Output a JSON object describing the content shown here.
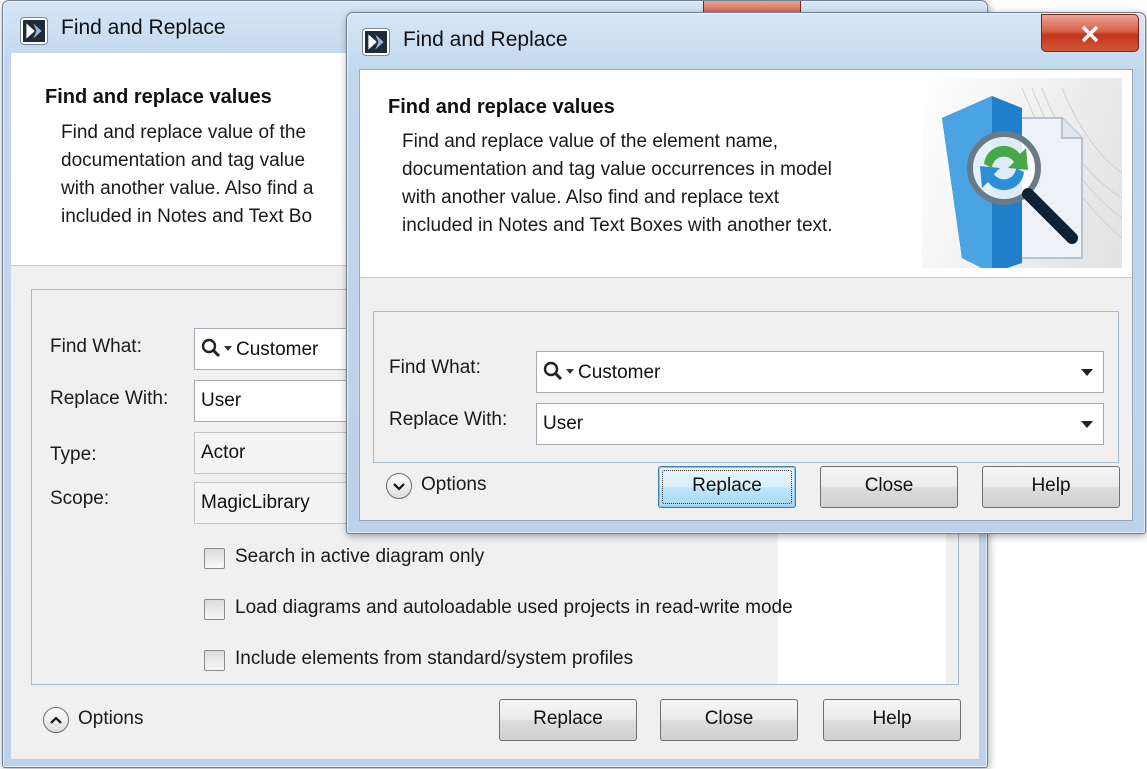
{
  "back_dialog": {
    "title": "Find and Replace",
    "header_title": "Find and replace values",
    "header_desc_lines": [
      "Find and replace value of the",
      "documentation and tag value",
      "with another value. Also find a",
      "included in Notes and Text Bo"
    ],
    "fields": {
      "find_label": "Find What:",
      "find_value": "Customer",
      "replace_label": "Replace With:",
      "replace_value": "User",
      "type_label": "Type:",
      "type_value": "Actor",
      "scope_label": "Scope:",
      "scope_value": "MagicLibrary"
    },
    "checkboxes": [
      {
        "label": "Search in active diagram only",
        "checked": false
      },
      {
        "label": "Load diagrams and autoloadable used projects in read-write mode",
        "checked": false
      },
      {
        "label": "Include elements from standard/system profiles",
        "checked": false
      }
    ],
    "options_label": "Options",
    "options_icon": "chevron-up-icon",
    "buttons": {
      "replace": "Replace",
      "close": "Close",
      "help": "Help"
    }
  },
  "front_dialog": {
    "title": "Find and Replace",
    "close_glyph": "x",
    "header_title": "Find and replace values",
    "header_desc": "Find and replace value of the element name,\ndocumentation and tag value occurrences in model\nwith another value. Also find and replace text\nincluded in Notes and Text Boxes with another text.",
    "fields": {
      "find_label": "Find What:",
      "find_value": "Customer",
      "replace_label": "Replace With:",
      "replace_value": "User"
    },
    "options_label": "Options",
    "options_icon": "chevron-down-icon",
    "buttons": {
      "replace": "Replace",
      "close": "Close",
      "help": "Help"
    },
    "default_button": "replace"
  },
  "colors": {
    "title_bar": "#c2d7ee",
    "close_button": "#c2351b",
    "default_button": "#bee6fd",
    "client_bg": "#f0f0f0"
  }
}
